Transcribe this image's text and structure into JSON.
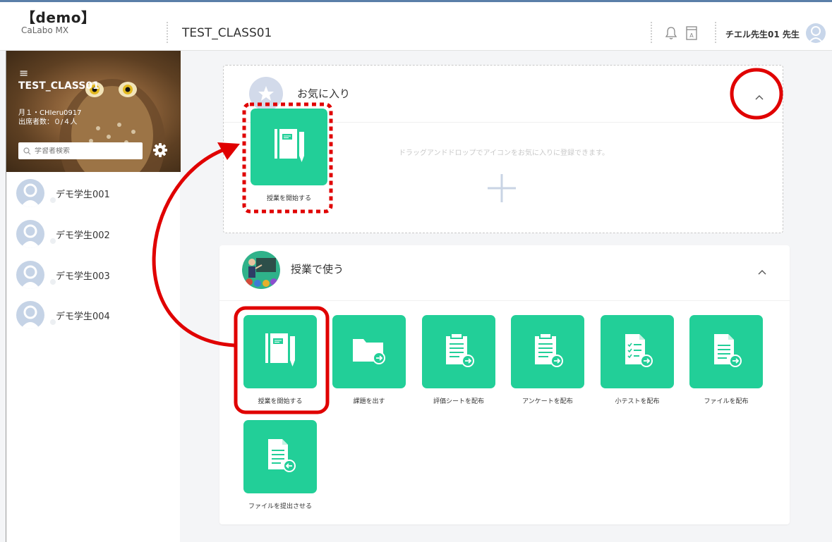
{
  "header": {
    "brand": "【demo】",
    "brand_sub": "CaLabo MX",
    "class_title": "TEST_CLASS01",
    "teacher": "チエル先生01 先生"
  },
  "sidebar": {
    "class_name": "TEST_CLASS01",
    "meta_line1": "月１・CHIeru0917",
    "meta_line2": "出席者数：０/４人",
    "search_placeholder": "学習者検索",
    "students": [
      "デモ学生001",
      "デモ学生002",
      "デモ学生003",
      "デモ学生004"
    ]
  },
  "favorites": {
    "title": "お気に入り",
    "hint": "ドラッグアンドドロップでアイコンをお気に入りに登録できます。",
    "tile_label": "授業を開始する"
  },
  "class_section": {
    "title": "授業で使う",
    "tiles": [
      {
        "label": "授業を開始する",
        "icon": "notebook-icon"
      },
      {
        "label": "課題を出す",
        "icon": "folder-arrow-icon"
      },
      {
        "label": "評価シートを配布",
        "icon": "clipboard-arrow-icon"
      },
      {
        "label": "アンケートを配布",
        "icon": "clipboard-arrow-icon"
      },
      {
        "label": "小テストを配布",
        "icon": "checklist-arrow-icon"
      },
      {
        "label": "ファイルを配布",
        "icon": "document-arrow-icon"
      },
      {
        "label": "ファイルを提出させる",
        "icon": "document-return-icon"
      }
    ]
  },
  "colors": {
    "tile_green": "#22cf98",
    "annotation_red": "#e00000",
    "header_border": "#5a7fa8"
  }
}
